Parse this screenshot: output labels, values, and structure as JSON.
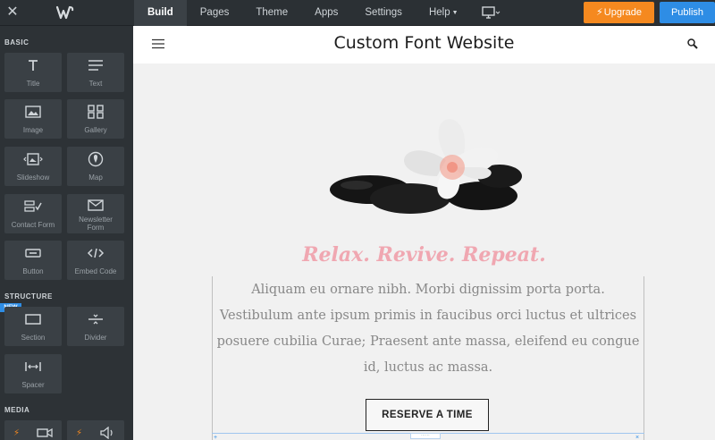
{
  "topbar": {
    "nav": [
      "Build",
      "Pages",
      "Theme",
      "Apps",
      "Settings",
      "Help"
    ],
    "upgrade_label": "Upgrade",
    "publish_label": "Publish",
    "colors": {
      "upgrade": "#f5891f",
      "publish": "#2e8de5"
    }
  },
  "sidebar": {
    "sections": {
      "basic": "BASIC",
      "structure": "STRUCTURE",
      "media": "MEDIA"
    },
    "new_badge": "NEW",
    "basic_tiles": [
      "Title",
      "Text",
      "Image",
      "Gallery",
      "Slideshow",
      "Map",
      "Contact Form",
      "Newsletter Form",
      "Button",
      "Embed Code"
    ],
    "structure_tiles": [
      "Section",
      "Divider",
      "Spacer"
    ],
    "media_tiles": [
      "video-icon",
      "audio-icon"
    ]
  },
  "site": {
    "title": "Custom Font Website",
    "tagline": "Relax. Revive. Repeat.",
    "body": "Aliquam eu ornare nibh. Morbi dignissim porta porta. Vestibulum ante ipsum primis in faucibus orci luctus et ultrices posuere cubilia Curae; Praesent ante massa, eleifend eu congue id, luctus ac massa.",
    "button_label": "RESERVE A TIME",
    "tagline_color": "#f0a7b1"
  }
}
